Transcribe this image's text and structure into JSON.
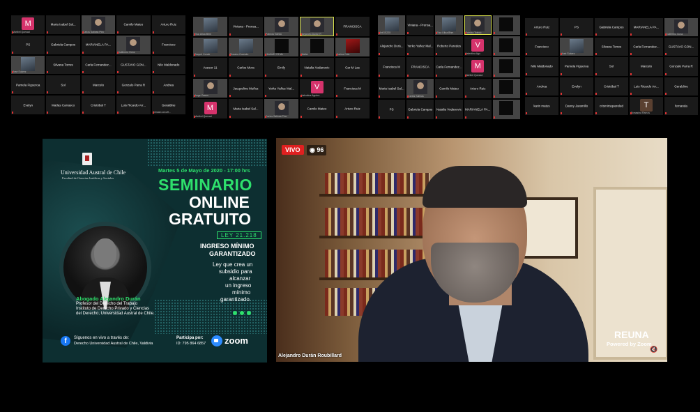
{
  "window": {
    "title": "Zoom meeting with live stream"
  },
  "grid1": [
    {
      "name": "",
      "sub": "Maribel Quesad",
      "avatar": "M",
      "color": "#d6336c"
    },
    {
      "name": "Maria Isabel Sal...",
      "sub": ""
    },
    {
      "name": "",
      "sub": "Carlos Salinas Pinc",
      "video": "face"
    },
    {
      "name": "Camilo Mateo",
      "sub": ""
    },
    {
      "name": "Arturo Ruiz",
      "sub": ""
    },
    {
      "name": "PS",
      "sub": ""
    },
    {
      "name": "Gabriela Campos",
      "sub": ""
    },
    {
      "name": "MARIANELA PA...",
      "sub": ""
    },
    {
      "name": "",
      "sub": "Guillermo Gonz",
      "video": "face"
    },
    {
      "name": "Francisco",
      "sub": ""
    },
    {
      "name": "",
      "sub": "José Suárez",
      "video": "room"
    },
    {
      "name": "Silvana Torres",
      "sub": ""
    },
    {
      "name": "Carla Fernandez...",
      "sub": ""
    },
    {
      "name": "GUSTAVO GON...",
      "sub": ""
    },
    {
      "name": "Nilo Maldonado",
      "sub": ""
    },
    {
      "name": "Pamela Figueroa",
      "sub": ""
    },
    {
      "name": "Sol",
      "sub": ""
    },
    {
      "name": "Marcelo",
      "sub": ""
    },
    {
      "name": "Gonzalo Parra R",
      "sub": ""
    },
    {
      "name": "Andrea",
      "sub": ""
    },
    {
      "name": "Evelyn",
      "sub": ""
    },
    {
      "name": "Matías Carrasco",
      "sub": ""
    },
    {
      "name": "Cristóbal T",
      "sub": ""
    },
    {
      "name": "Luis Ricardo Arr...",
      "sub": ""
    },
    {
      "name": "Geraldine",
      "sub": "Cristian cecoff..."
    }
  ],
  "grid2": [
    {
      "name": "",
      "sub": "Elsa Ulloa Bhm",
      "video": "room"
    },
    {
      "name": "Viviana - Prensa...",
      "sub": ""
    },
    {
      "name": "",
      "sub": "Patricia Toledo",
      "video": "face"
    },
    {
      "name": "",
      "sub": "Alejandro Durán R",
      "video": "face",
      "hl": true
    },
    {
      "name": "FRANCISCA",
      "sub": ""
    },
    {
      "name": "",
      "sub": "Raquel Conde",
      "video": "room"
    },
    {
      "name": "",
      "sub": "Rosana Guzmán",
      "video": "room"
    },
    {
      "name": "",
      "sub": "HUAWEI Y9 Me",
      "video": "dark"
    },
    {
      "name": "",
      "sub": "Walter",
      "video": "dark"
    },
    {
      "name": "",
      "sub": "Karina Colo",
      "video": "red"
    },
    {
      "name": "Asesor 11",
      "sub": ""
    },
    {
      "name": "Carlos Mora",
      "sub": ""
    },
    {
      "name": "Emily",
      "sub": ""
    },
    {
      "name": "Natalia Vodanovic",
      "sub": ""
    },
    {
      "name": "Car M Las",
      "sub": ""
    },
    {
      "name": "",
      "sub": "Jorge Oasos",
      "video": "face"
    },
    {
      "name": "Jacqueline Muñoz",
      "sub": ""
    },
    {
      "name": "Yerko Yañez Mal...",
      "sub": ""
    },
    {
      "name": "",
      "sub": "Valentina Aguirre",
      "avatar": "V",
      "color": "#d6336c"
    },
    {
      "name": "Francisca M",
      "sub": ""
    },
    {
      "name": "",
      "sub": "Maribel Quezad",
      "avatar": "M",
      "color": "#d6336c"
    },
    {
      "name": "Maria Isabel Sal...",
      "sub": ""
    },
    {
      "name": "",
      "sub": "Carlos Salinas Pinc",
      "video": "face"
    },
    {
      "name": "Camilo Mateo",
      "sub": ""
    },
    {
      "name": "Arturo Ruiz",
      "sub": ""
    }
  ],
  "grid3": [
    {
      "name": "",
      "sub": "AntGS225",
      "video": "room"
    },
    {
      "name": "Viviana - Prensa...",
      "sub": ""
    },
    {
      "name": "",
      "sub": "Elsa Ulloa Bhm",
      "video": "room"
    },
    {
      "name": "",
      "sub": "Patricia Toledo",
      "video": "face",
      "hl": true
    },
    {
      "name": "",
      "sub": "",
      "video": "dark"
    },
    {
      "name": "Alejandro Durá...",
      "sub": ""
    },
    {
      "name": "Yerko Yañez Mal...",
      "sub": ""
    },
    {
      "name": "Roberto Paredes",
      "sub": ""
    },
    {
      "name": "",
      "sub": "Valentina Agu",
      "avatar": "V",
      "color": "#d6336c"
    },
    {
      "name": "",
      "sub": "",
      "video": "dark"
    },
    {
      "name": "Francisca M",
      "sub": ""
    },
    {
      "name": "FRANCISCA",
      "sub": ""
    },
    {
      "name": "Carla Fernandez...",
      "sub": ""
    },
    {
      "name": "",
      "sub": "Maribel Quezad",
      "avatar": "M",
      "color": "#d6336c"
    },
    {
      "name": "",
      "sub": "",
      "video": "dark"
    },
    {
      "name": "Maria Isabel Sal...",
      "sub": ""
    },
    {
      "name": "",
      "sub": "Carlos Salinas",
      "video": "face"
    },
    {
      "name": "Camilo Mateo",
      "sub": ""
    },
    {
      "name": "Arturo Ruiz",
      "sub": ""
    },
    {
      "name": "",
      "sub": "",
      "video": "dark"
    },
    {
      "name": "PS",
      "sub": ""
    },
    {
      "name": "Gabriela Campos",
      "sub": ""
    },
    {
      "name": "Natalia Vodanovic",
      "sub": ""
    },
    {
      "name": "MARIANELA PA...",
      "sub": ""
    },
    {
      "name": "",
      "sub": "",
      "video": "dark"
    }
  ],
  "grid4": [
    {
      "name": "Arturo Ruiz",
      "sub": ""
    },
    {
      "name": "PS",
      "sub": ""
    },
    {
      "name": "Gabriela Campos",
      "sub": ""
    },
    {
      "name": "MARIANELA PA...",
      "sub": ""
    },
    {
      "name": "",
      "sub": "Guillermo Gonz",
      "video": "face"
    },
    {
      "name": "Francisco",
      "sub": ""
    },
    {
      "name": "",
      "sub": "José Suárez",
      "video": "room"
    },
    {
      "name": "Silvana Torres",
      "sub": ""
    },
    {
      "name": "Carla Fernandez...",
      "sub": ""
    },
    {
      "name": "GUSTAVO GON...",
      "sub": ""
    },
    {
      "name": "Nilo Maldonado",
      "sub": ""
    },
    {
      "name": "Pamela Figueroa",
      "sub": ""
    },
    {
      "name": "Sol",
      "sub": ""
    },
    {
      "name": "Marcelo",
      "sub": ""
    },
    {
      "name": "Gonzalo Parra R",
      "sub": ""
    },
    {
      "name": "Andrea",
      "sub": ""
    },
    {
      "name": "Evelyn",
      "sub": ""
    },
    {
      "name": "Cristóbal T",
      "sub": ""
    },
    {
      "name": "Luis Ricardo Arr...",
      "sub": ""
    },
    {
      "name": "Geraldine",
      "sub": ""
    },
    {
      "name": "karin matus",
      "sub": ""
    },
    {
      "name": "Danny Jaramillo",
      "sub": ""
    },
    {
      "name": "crismirisquereled",
      "sub": ""
    },
    {
      "name": "",
      "sub": "Tomasina Ramos",
      "avatar": "T",
      "color": "#5a4030"
    },
    {
      "name": "fernanda",
      "sub": ""
    }
  ],
  "poster": {
    "university": "Universidad Austral de Chile",
    "faculty": "Facultad de Ciencias Jurídicas y Sociales",
    "date": "Martes 5 de Mayo de 2020 - 17:00 hrs",
    "title1": "SEMINARIO",
    "title2": "ONLINE",
    "title3": "GRATUITO",
    "law": "LEY 21.218",
    "topic1": "INGRESO MÍNIMO",
    "topic2": "GARANTIZADO",
    "desc1": "Ley que crea un",
    "desc2": "subsidio para",
    "desc3": "alcanzar",
    "desc4": "un ingreso",
    "desc5": "mínimo",
    "desc6": "garantizado.",
    "speaker": "Abogado Alejandro Durán",
    "role1": "Profesor del Derecho del Trabajo",
    "role2": "Instituto de Derecho Privado y Ciencias",
    "role3": "del Derecho, Universidad Austral de Chile.",
    "follow1": "Síguenos en vivo a través de:",
    "follow2": "Derecho Universidad Austral de Chile, Valdivia",
    "join1": "Participa por:",
    "join2": "ID: 795 864 6857",
    "zoom": "zoom",
    "fb_icon": "f"
  },
  "stream": {
    "live": "VIVO",
    "viewers": "96",
    "speaker_name": "Alejandro Durán Roubillard",
    "brand": "REUNA",
    "powered": "Powered by Zoom",
    "speaker_icon": "🔇"
  }
}
